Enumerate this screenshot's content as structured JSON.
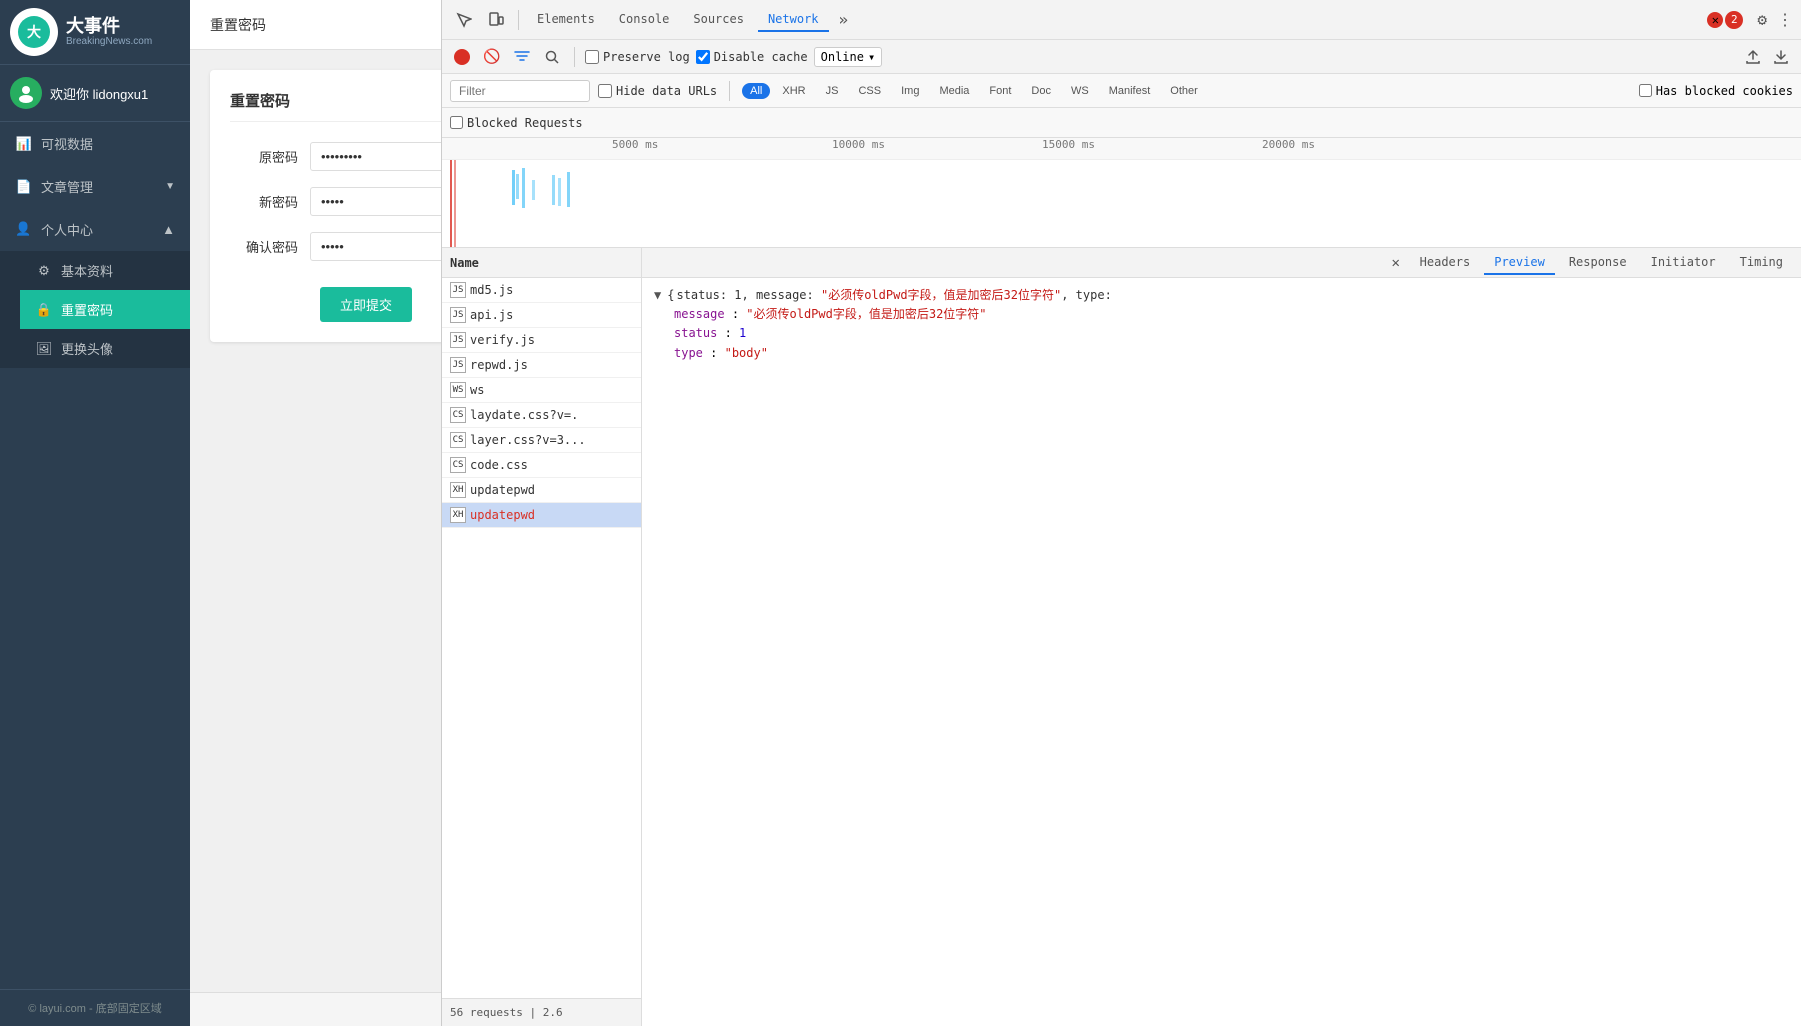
{
  "app": {
    "name": "大事件",
    "sub": "BreakingNews.com",
    "user": "欢迎你 lidongxu1"
  },
  "sidebar": {
    "nav": [
      {
        "id": "ke-shi",
        "label": "可视数据",
        "icon": "chart",
        "arrow": ""
      },
      {
        "id": "wen-zhang",
        "label": "文章管理",
        "icon": "doc",
        "arrow": "▼"
      },
      {
        "id": "ge-ren",
        "label": "个人中心",
        "icon": "person",
        "arrow": "▲",
        "expanded": true
      },
      {
        "id": "ji-ben",
        "label": "基本资料",
        "icon": "info",
        "sub": true
      },
      {
        "id": "chong-zhi",
        "label": "重置密码",
        "icon": "lock",
        "sub": true,
        "active": true
      },
      {
        "id": "geng-huan",
        "label": "更换头像",
        "icon": "img",
        "sub": true
      }
    ],
    "footer": "© layui.com - 底部固定区域"
  },
  "topbar": {
    "title": "重置密码"
  },
  "form": {
    "title": "重置密码",
    "fields": [
      {
        "label": "原密码",
        "type": "password",
        "value": "·········"
      },
      {
        "label": "新密码",
        "type": "password",
        "value": "·····"
      },
      {
        "label": "确认密码",
        "type": "password",
        "value": "·····"
      }
    ],
    "submit": "立即提交"
  },
  "devtools": {
    "tabs": [
      "Elements",
      "Console",
      "Sources",
      "Network"
    ],
    "active_tab": "Network",
    "toolbar": {
      "record_title": "Stop recording network log",
      "clear_title": "Clear",
      "filter_title": "Filter",
      "search_title": "Search",
      "preserve_log": false,
      "disable_cache": true,
      "online_label": "Online"
    },
    "filter": {
      "placeholder": "Filter",
      "hide_data_urls": false,
      "types": [
        "All",
        "XHR",
        "JS",
        "CSS",
        "Img",
        "Media",
        "Font",
        "Doc",
        "WS",
        "Manifest",
        "Other"
      ],
      "active_type": "All",
      "has_blocked_cookies": false,
      "blocked_requests": false
    },
    "timeline": {
      "labels": [
        "5000 ms",
        "10000 ms",
        "15000 ms",
        "20000 ms"
      ]
    },
    "name_panel": {
      "header": "Name",
      "items": [
        {
          "name": "md5.js",
          "selected": false,
          "error": false
        },
        {
          "name": "api.js",
          "selected": false,
          "error": false
        },
        {
          "name": "verify.js",
          "selected": false,
          "error": false
        },
        {
          "name": "repwd.js",
          "selected": false,
          "error": false
        },
        {
          "name": "ws",
          "selected": false,
          "error": false
        },
        {
          "name": "laydate.css?v=.",
          "selected": false,
          "error": false
        },
        {
          "name": "layer.css?v=3...",
          "selected": false,
          "error": false
        },
        {
          "name": "code.css",
          "selected": false,
          "error": false
        },
        {
          "name": "updatepwd",
          "selected": false,
          "error": false
        },
        {
          "name": "updatepwd",
          "selected": true,
          "error": true
        }
      ],
      "footer": "56 requests | 2.6"
    },
    "detail": {
      "tabs": [
        "Headers",
        "Preview",
        "Response",
        "Initiator",
        "Timing"
      ],
      "active_tab": "Preview",
      "json_preview": {
        "root_line": "{status: 1, message: \"必须传oldPwd字段，值是加密后32位字符\", type:",
        "fields": [
          {
            "key": "message",
            "value": "\"必须传oldPwd字段，值是加密后32位字符\"",
            "type": "string"
          },
          {
            "key": "status",
            "value": "1",
            "type": "number"
          },
          {
            "key": "type",
            "value": "\"body\"",
            "type": "string"
          }
        ]
      }
    },
    "error_count": "2"
  }
}
